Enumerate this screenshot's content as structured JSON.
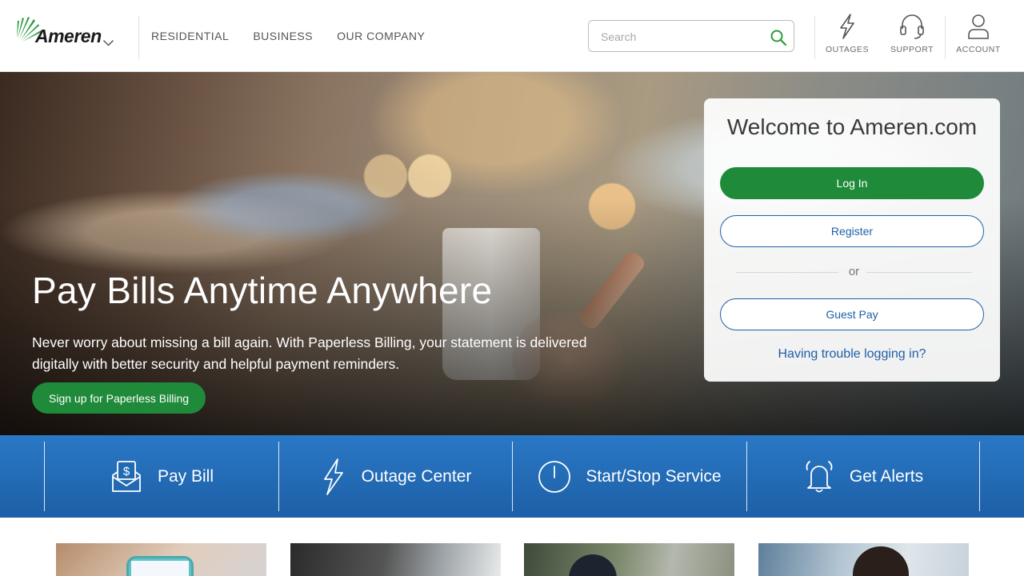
{
  "brand": {
    "name": "Ameren"
  },
  "nav": {
    "items": [
      "RESIDENTIAL",
      "BUSINESS",
      "OUR COMPANY"
    ]
  },
  "search": {
    "placeholder": "Search",
    "value": ""
  },
  "utility": {
    "outages": "OUTAGES",
    "support": "SUPPORT",
    "account": "ACCOUNT"
  },
  "hero": {
    "title": "Pay Bills Anytime Anywhere",
    "text": "Never worry about missing a bill again. With Paperless Billing, your statement is delivered digitally with better security and helpful payment reminders.",
    "cta": "Sign up for Paperless Billing"
  },
  "login": {
    "title": "Welcome to Ameren.com",
    "login_label": "Log In",
    "register_label": "Register",
    "or_label": "or",
    "guest_label": "Guest Pay",
    "trouble_label": "Having trouble logging in?"
  },
  "quick_links": [
    {
      "label": "Pay Bill",
      "icon": "pay-bill-icon"
    },
    {
      "label": "Outage Center",
      "icon": "lightning-bolt-icon"
    },
    {
      "label": "Start/Stop Service",
      "icon": "power-icon"
    },
    {
      "label": "Get Alerts",
      "icon": "bell-icon"
    }
  ],
  "colors": {
    "primary_green": "#1f8a3a",
    "primary_blue": "#1e5fa8",
    "bar_blue": "#2a78c6"
  }
}
